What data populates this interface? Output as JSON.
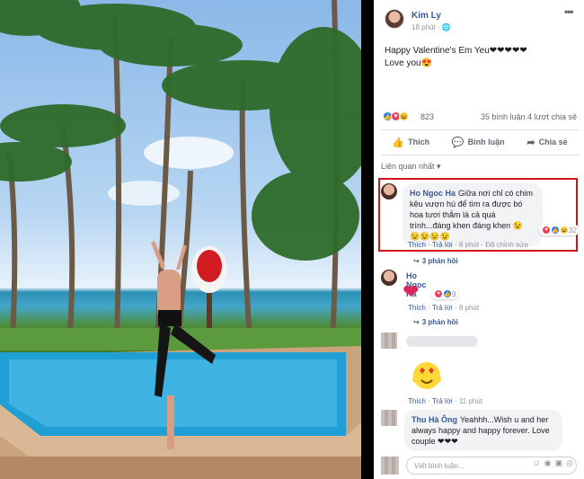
{
  "post": {
    "author": "Kim Ly",
    "time": "18 phút · ",
    "globe_icon": "globe-icon",
    "line1": "Happy Valentine's Em Yeu❤❤❤❤❤",
    "line2": "Love you😍",
    "reaction_count": "823",
    "stats_right": "35 bình luận  4 lượt chia sẻ",
    "actions": {
      "like": "Thích",
      "comment": "Bình luận",
      "share": "Chia sẻ"
    }
  },
  "comments_header": "Liên quan nhất ▾",
  "comments": [
    {
      "name": "Ho Ngoc Ha",
      "text": "Giữa nơi chỉ có chim kêu vượn hú để tìm ra được bó hoa tươi thắm là cả quá trình...đáng khen đáng khen 😉",
      "text2": "😉😉😉😉",
      "react_count": "32",
      "meta": {
        "like": "Thích",
        "reply": "Trả lời",
        "time": "8 phút",
        "edited": "Đã chỉnh sửa"
      },
      "replies": "3 phản hồi"
    },
    {
      "name": "Ho Ngoc Ha",
      "react_count": "9",
      "meta": {
        "like": "Thích",
        "reply": "Trả lời",
        "time": "8 phút"
      },
      "replies": "3 phản hồi"
    },
    {
      "meta": {
        "like": "Thích",
        "reply": "Trả lời",
        "time": "11 phút"
      }
    },
    {
      "name": "Thu Hà Ông",
      "text": "Yeahhh...Wish u and her always happy and happy forever. Love couple ❤❤❤"
    }
  ],
  "composer": {
    "placeholder": "Viết bình luận..."
  }
}
